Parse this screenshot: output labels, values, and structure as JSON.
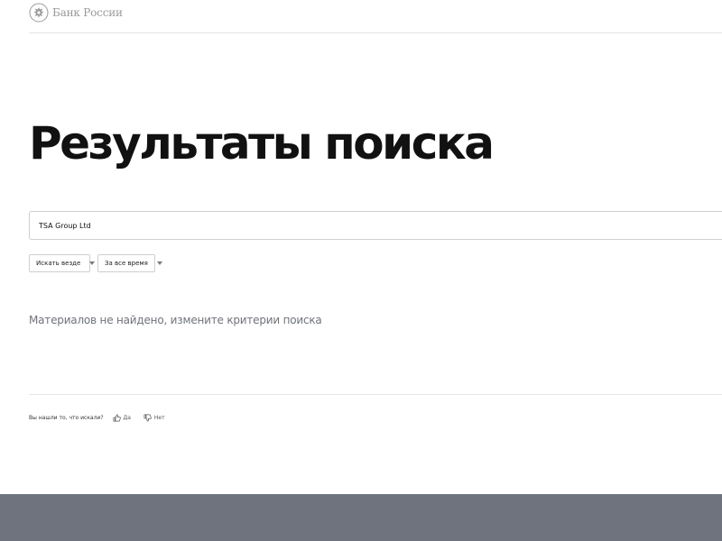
{
  "header": {
    "logo_text": "Банк России",
    "logo_icon": "double-headed-eagle-emblem"
  },
  "page": {
    "title": "Результаты поиска"
  },
  "search": {
    "value": "TSA Group Ltd",
    "placeholder": ""
  },
  "filters": {
    "scope": {
      "selected": "Искать везде",
      "icon": "chevron-down-icon"
    },
    "period": {
      "selected": "За все время",
      "icon": "chevron-down-icon"
    }
  },
  "results": {
    "empty_message": "Материалов не найдено, измените критерии поиска"
  },
  "feedback": {
    "question": "Вы нашли то, что искали?",
    "yes_label": "Да",
    "no_label": "Нет",
    "yes_icon": "thumbs-up-icon",
    "no_icon": "thumbs-down-icon"
  },
  "colors": {
    "footer_bg": "#6f737e",
    "muted_text": "#6f7379",
    "logo_text": "#9a9a9a"
  }
}
